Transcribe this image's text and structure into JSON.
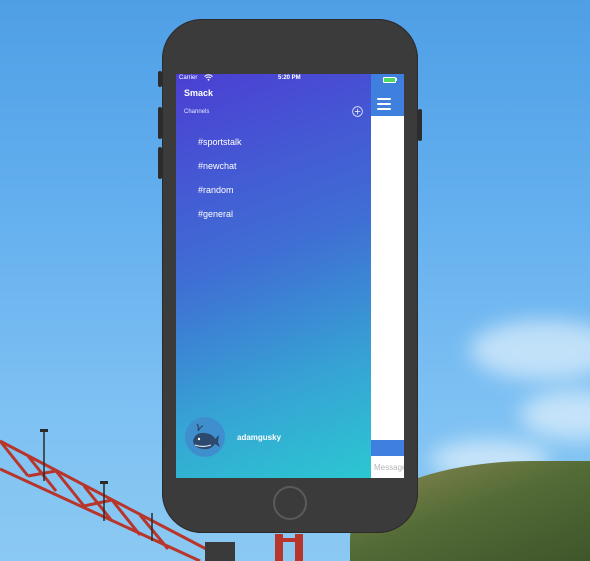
{
  "status_bar": {
    "carrier": "Carrier",
    "wifi_icon": "wifi-icon",
    "time": "5:20 PM"
  },
  "menu": {
    "app_title": "Smack",
    "channels_header": "Channels",
    "add_icon": "add-channel-icon",
    "channels": [
      "#sportstalk",
      "#newchat",
      "#random",
      "#general"
    ],
    "username": "adamgusky",
    "avatar_icon": "whale-avatar-icon",
    "gradient": [
      "#4b3fd3",
      "#3f6fd4",
      "#36a4d4",
      "#2bc7d2"
    ]
  },
  "chat": {
    "menu_icon": "hamburger-icon",
    "message_placeholder": "Message",
    "accent": "#3f7fdd",
    "battery_color": "#4cd964"
  }
}
